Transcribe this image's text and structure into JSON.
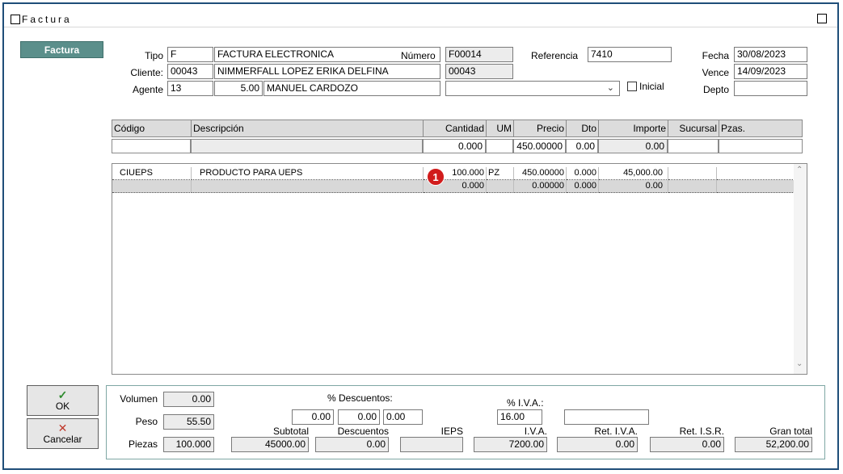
{
  "window": {
    "title": "Factura"
  },
  "tab": {
    "label": "Factura"
  },
  "header": {
    "tipo_label": "Tipo",
    "tipo_code": "F",
    "tipo_desc": "FACTURA ELECTRONICA",
    "numero_label": "Número",
    "numero": "F00014",
    "referencia_label": "Referencia",
    "referencia": "7410",
    "fecha_label": "Fecha",
    "fecha": "30/08/2023",
    "cliente_label": "Cliente:",
    "cliente_code": "00043",
    "cliente_name": "NIMMERFALL LOPEZ ERIKA DELFINA",
    "cliente_extra": "00043",
    "vence_label": "Vence",
    "vence": "14/09/2023",
    "agente_label": "Agente",
    "agente_code": "13",
    "agente_pct": "5.00",
    "agente_name": "MANUEL CARDOZO",
    "combo_value": "",
    "inicial_label": "Inicial",
    "depto_label": "Depto",
    "depto": ""
  },
  "grid": {
    "columns": [
      "Código",
      "Descripción",
      "Cantidad",
      "UM",
      "Precio",
      "Dto",
      "Importe",
      "Sucursal",
      "Pzas."
    ],
    "input_row": {
      "codigo": "",
      "descripcion": "",
      "cantidad": "0.000",
      "um": "",
      "precio": "450.00000",
      "dto": "0.00",
      "importe": "0.00",
      "sucursal": "",
      "pzas": ""
    },
    "rows": [
      {
        "codigo": "CIUEPS",
        "descripcion": "PRODUCTO PARA UEPS",
        "cantidad": "100.000",
        "um": "PZ",
        "precio": "450.00000",
        "dto": "0.000",
        "importe": "45,000.00",
        "sucursal": "",
        "pzas": ""
      },
      {
        "codigo": "",
        "descripcion": "",
        "cantidad": "0.000",
        "um": "",
        "precio": "0.00000",
        "dto": "0.000",
        "importe": "0.00",
        "sucursal": "",
        "pzas": ""
      }
    ],
    "marker": "1"
  },
  "buttons": {
    "ok": "OK",
    "cancel": "Cancelar"
  },
  "totals": {
    "volumen_label": "Volumen",
    "volumen": "0.00",
    "peso_label": "Peso",
    "peso": "55.50",
    "piezas_label": "Piezas",
    "piezas": "100.000",
    "descuentos_pct_label": "% Descuentos:",
    "desc1": "0.00",
    "desc2": "0.00",
    "desc3": "0.00",
    "iva_pct_label": "% I.V.A.:",
    "iva_pct": "16.00",
    "extra_field": "",
    "subtotal_label": "Subtotal",
    "subtotal": "45000.00",
    "descuentos_label": "Descuentos",
    "descuentos": "0.00",
    "ieps_label": "IEPS",
    "ieps": "",
    "iva_label": "I.V.A.",
    "iva": "7200.00",
    "ret_iva_label": "Ret. I.V.A.",
    "ret_iva": "0.00",
    "ret_isr_label": "Ret. I.S.R.",
    "ret_isr": "0.00",
    "gran_total_label": "Gran total",
    "gran_total": "52,200.00"
  },
  "colors": {
    "frame": "#1f4e79",
    "tab": "#5b8f8b",
    "marker": "#d11c1c",
    "ok_check": "#2e8b2e",
    "cancel_x": "#c0392b"
  }
}
